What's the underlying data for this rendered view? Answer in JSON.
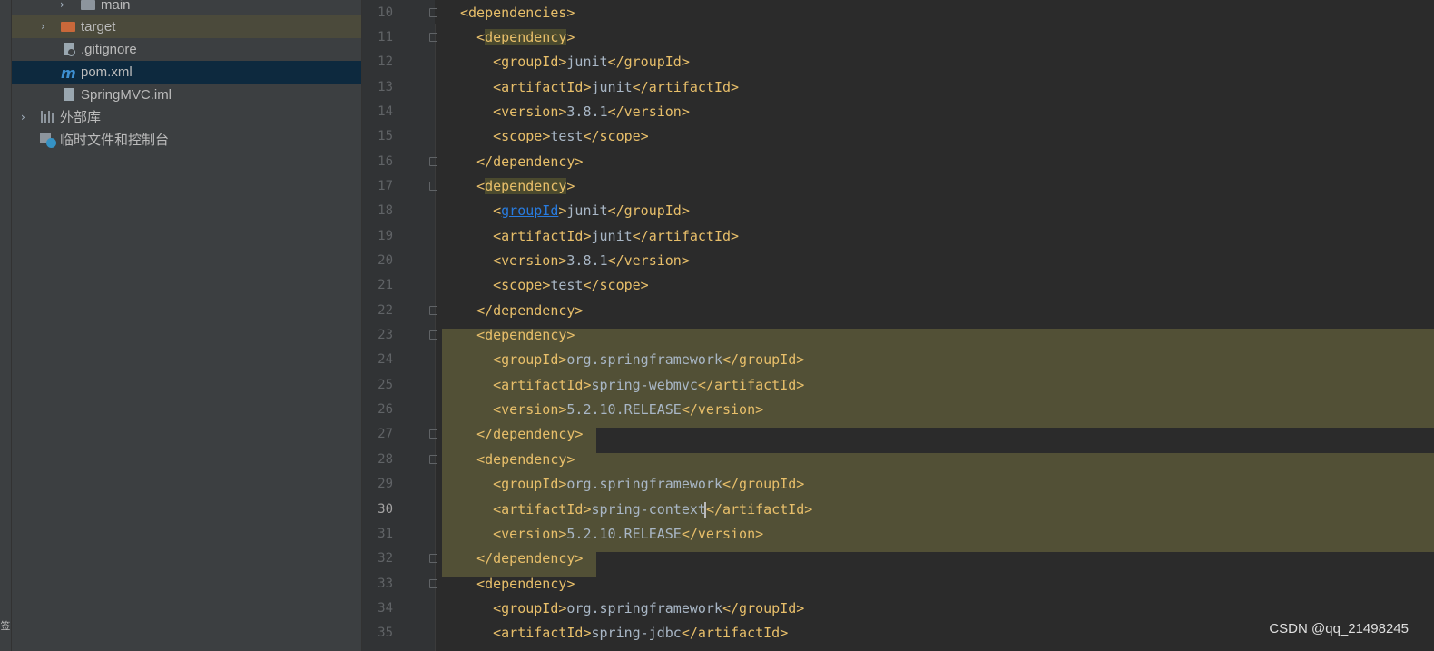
{
  "sidebar": {
    "items": [
      {
        "label": "main",
        "icon": "folder-icon"
      },
      {
        "label": "target",
        "icon": "folder-icon"
      },
      {
        "label": ".gitignore",
        "icon": "file-icon"
      },
      {
        "label": "pom.xml",
        "icon": "maven-icon"
      },
      {
        "label": "SpringMVC.iml",
        "icon": "file-icon"
      },
      {
        "label": "外部库",
        "icon": "library-icon"
      },
      {
        "label": "临时文件和控制台",
        "icon": "scratch-icon"
      }
    ],
    "stripe_label": "签"
  },
  "editor": {
    "lines": [
      {
        "n": "10",
        "indent": "",
        "tag": "dependencies",
        "type": "open"
      },
      {
        "n": "11",
        "indent": "  ",
        "tag": "dependency",
        "type": "open"
      },
      {
        "n": "12",
        "indent": "    ",
        "tag": "groupId",
        "value": "junit",
        "type": "full"
      },
      {
        "n": "13",
        "indent": "    ",
        "tag": "artifactId",
        "value": "junit",
        "type": "full"
      },
      {
        "n": "14",
        "indent": "    ",
        "tag": "version",
        "value": "3.8.1",
        "type": "full"
      },
      {
        "n": "15",
        "indent": "    ",
        "tag": "scope",
        "value": "test",
        "type": "full"
      },
      {
        "n": "16",
        "indent": "  ",
        "tag": "dependency",
        "type": "close"
      },
      {
        "n": "17",
        "indent": "  ",
        "tag": "dependency",
        "type": "open"
      },
      {
        "n": "18",
        "indent": "    ",
        "tag": "groupId",
        "value": "junit",
        "type": "full"
      },
      {
        "n": "19",
        "indent": "    ",
        "tag": "artifactId",
        "value": "junit",
        "type": "full"
      },
      {
        "n": "20",
        "indent": "    ",
        "tag": "version",
        "value": "3.8.1",
        "type": "full"
      },
      {
        "n": "21",
        "indent": "    ",
        "tag": "scope",
        "value": "test",
        "type": "full"
      },
      {
        "n": "22",
        "indent": "  ",
        "tag": "dependency",
        "type": "close"
      },
      {
        "n": "23",
        "indent": "  ",
        "tag": "dependency",
        "type": "open"
      },
      {
        "n": "24",
        "indent": "    ",
        "tag": "groupId",
        "value": "org.springframework",
        "type": "full"
      },
      {
        "n": "25",
        "indent": "    ",
        "tag": "artifactId",
        "value": "spring-webmvc",
        "type": "full"
      },
      {
        "n": "26",
        "indent": "    ",
        "tag": "version",
        "value": "5.2.10.RELEASE",
        "type": "full"
      },
      {
        "n": "27",
        "indent": "  ",
        "tag": "dependency",
        "type": "close"
      },
      {
        "n": "28",
        "indent": "  ",
        "tag": "dependency",
        "type": "open"
      },
      {
        "n": "29",
        "indent": "    ",
        "tag": "groupId",
        "value": "org.springframework",
        "type": "full"
      },
      {
        "n": "30",
        "indent": "    ",
        "tag": "artifactId",
        "value": "spring-context",
        "type": "full"
      },
      {
        "n": "31",
        "indent": "    ",
        "tag": "version",
        "value": "5.2.10.RELEASE",
        "type": "full"
      },
      {
        "n": "32",
        "indent": "  ",
        "tag": "dependency",
        "type": "close"
      },
      {
        "n": "33",
        "indent": "  ",
        "tag": "dependency",
        "type": "open"
      },
      {
        "n": "34",
        "indent": "    ",
        "tag": "groupId",
        "value": "org.springframework",
        "type": "full"
      },
      {
        "n": "35",
        "indent": "    ",
        "tag": "artifactId",
        "value": "spring-jdbc",
        "type": "full"
      }
    ],
    "current_line": "30"
  },
  "watermark": "CSDN @qq_21498245",
  "colors": {
    "tag": "#e8bf6a",
    "text": "#a9b7c6",
    "selection": "#525036",
    "link": "#287bde",
    "selected_row": "#0d293e"
  }
}
